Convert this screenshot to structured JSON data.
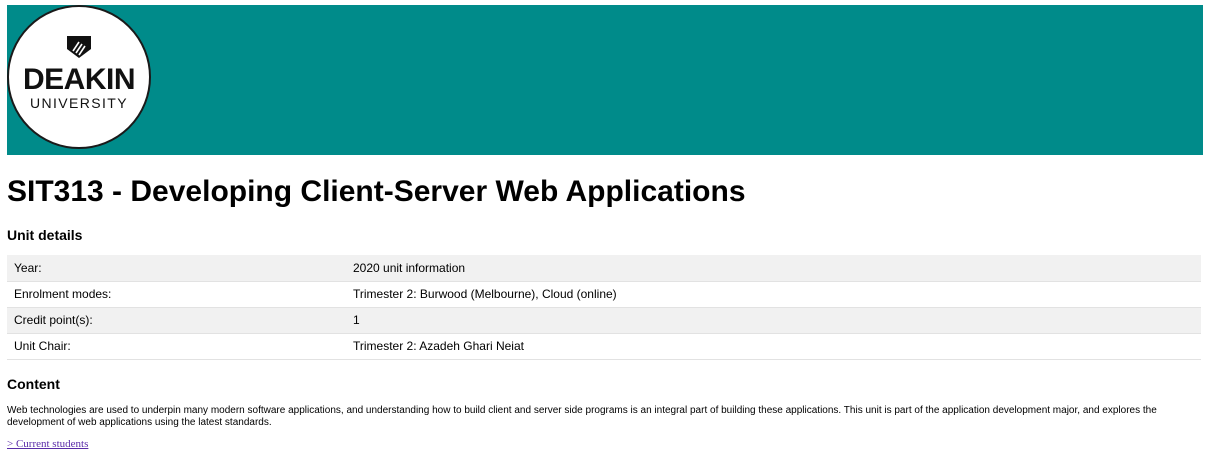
{
  "header": {
    "banner_color": "#008b8a",
    "logo": {
      "line1": "DEAKIN",
      "line2": "UNIVERSITY",
      "icon": "shield-icon"
    }
  },
  "title": "SIT313 - Developing Client-Server Web Applications",
  "unit_details": {
    "heading": "Unit details",
    "rows": [
      {
        "label": "Year:",
        "value": "2020 unit information"
      },
      {
        "label": "Enrolment modes:",
        "value": "Trimester 2: Burwood (Melbourne), Cloud (online)"
      },
      {
        "label": "Credit point(s):",
        "value": "1"
      },
      {
        "label": "Unit Chair:",
        "value": "Trimester 2: Azadeh Ghari Neiat"
      }
    ]
  },
  "content": {
    "heading": "Content",
    "text": "Web technologies are used to underpin many modern software applications, and understanding how to build client and server side programs is an integral part of building these applications. This unit is part of the application development major, and explores the development of web applications using the latest standards.",
    "link_label": "> Current students"
  }
}
